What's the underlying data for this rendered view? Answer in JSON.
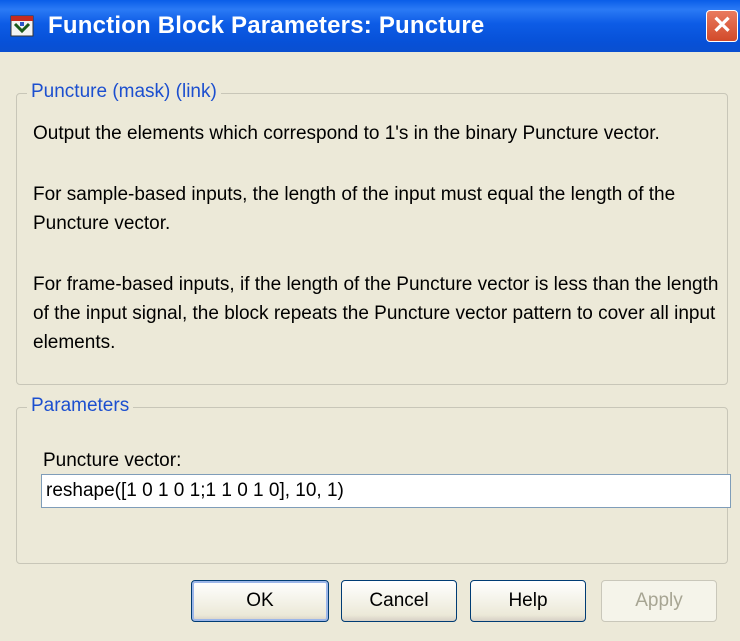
{
  "window": {
    "title": "Function Block Parameters: Puncture",
    "close_icon": "close-icon",
    "app_icon": "simulink-icon"
  },
  "description_group": {
    "title": "Puncture (mask) (link)",
    "paragraphs": [
      "Output the elements which correspond to 1's in the binary Puncture vector.",
      "For sample-based inputs, the length of the input must equal the length of the Puncture vector.",
      "For frame-based inputs, if the length of the Puncture vector is less than the length of the input signal, the block repeats the Puncture vector pattern to cover all input elements."
    ]
  },
  "parameters_group": {
    "title": "Parameters",
    "puncture_label": "Puncture vector:",
    "puncture_value": "reshape([1 0 1 0 1;1 1 0 1 0], 10, 1)"
  },
  "buttons": {
    "ok": "OK",
    "cancel": "Cancel",
    "help": "Help",
    "apply": "Apply"
  },
  "colors": {
    "titlebar": "#0a5ee8",
    "group_title": "#1c4fcf",
    "dialog_bg": "#ece9d8"
  }
}
